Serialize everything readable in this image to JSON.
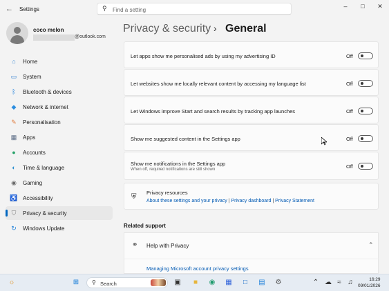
{
  "window": {
    "app_title": "Settings",
    "search_placeholder": "Find a setting",
    "back_icon": "back-arrow-icon",
    "controls": [
      "minimize",
      "maximize",
      "close"
    ]
  },
  "profile": {
    "name": "coco melon",
    "email_suffix": "@outlook.com"
  },
  "sidebar": {
    "items": [
      {
        "label": "Home",
        "icon": "home-icon",
        "color": "#3d8bd4"
      },
      {
        "label": "System",
        "icon": "system-icon",
        "color": "#2f7fd1"
      },
      {
        "label": "Bluetooth & devices",
        "icon": "bluetooth-icon",
        "color": "#0a73d9"
      },
      {
        "label": "Network & internet",
        "icon": "network-icon",
        "color": "#2a8de0"
      },
      {
        "label": "Personalisation",
        "icon": "brush-icon",
        "color": "#e07a3b"
      },
      {
        "label": "Apps",
        "icon": "apps-icon",
        "color": "#5a6b85"
      },
      {
        "label": "Accounts",
        "icon": "accounts-icon",
        "color": "#2aa36b"
      },
      {
        "label": "Time & language",
        "icon": "globe-clock-icon",
        "color": "#2d8fcf"
      },
      {
        "label": "Gaming",
        "icon": "gamepad-icon",
        "color": "#6b6b6b"
      },
      {
        "label": "Accessibility",
        "icon": "accessibility-icon",
        "color": "#1f6fc4"
      },
      {
        "label": "Privacy & security",
        "icon": "shield-icon",
        "color": "#7a7a7a",
        "active": true
      },
      {
        "label": "Windows Update",
        "icon": "update-icon",
        "color": "#1b7fd9"
      }
    ]
  },
  "page": {
    "parent": "Privacy & security",
    "separator": "›",
    "title": "General"
  },
  "settings": [
    {
      "title": "Let apps show me personalised ads by using my advertising ID",
      "state": "Off"
    },
    {
      "title": "Let websites show me locally relevant content by accessing my language list",
      "state": "Off"
    },
    {
      "title": "Let Windows improve Start and search results by tracking app launches",
      "state": "Off"
    },
    {
      "title": "Show me suggested content in the Settings app",
      "state": "Off"
    },
    {
      "title": "Show me notifications in the Settings app",
      "subtitle": "When off, required notifications are still shown",
      "state": "Off"
    }
  ],
  "privacy_resources": {
    "title": "Privacy resources",
    "links": [
      "About these settings and your privacy",
      "Privacy dashboard",
      "Privacy Statement"
    ],
    "separator": " | "
  },
  "related": {
    "heading": "Related support",
    "help_title": "Help with Privacy",
    "help_link": "Managing Microsoft account privacy settings"
  },
  "taskbar": {
    "search_label": "Search",
    "time": "16:29",
    "date": "09/01/2026"
  }
}
